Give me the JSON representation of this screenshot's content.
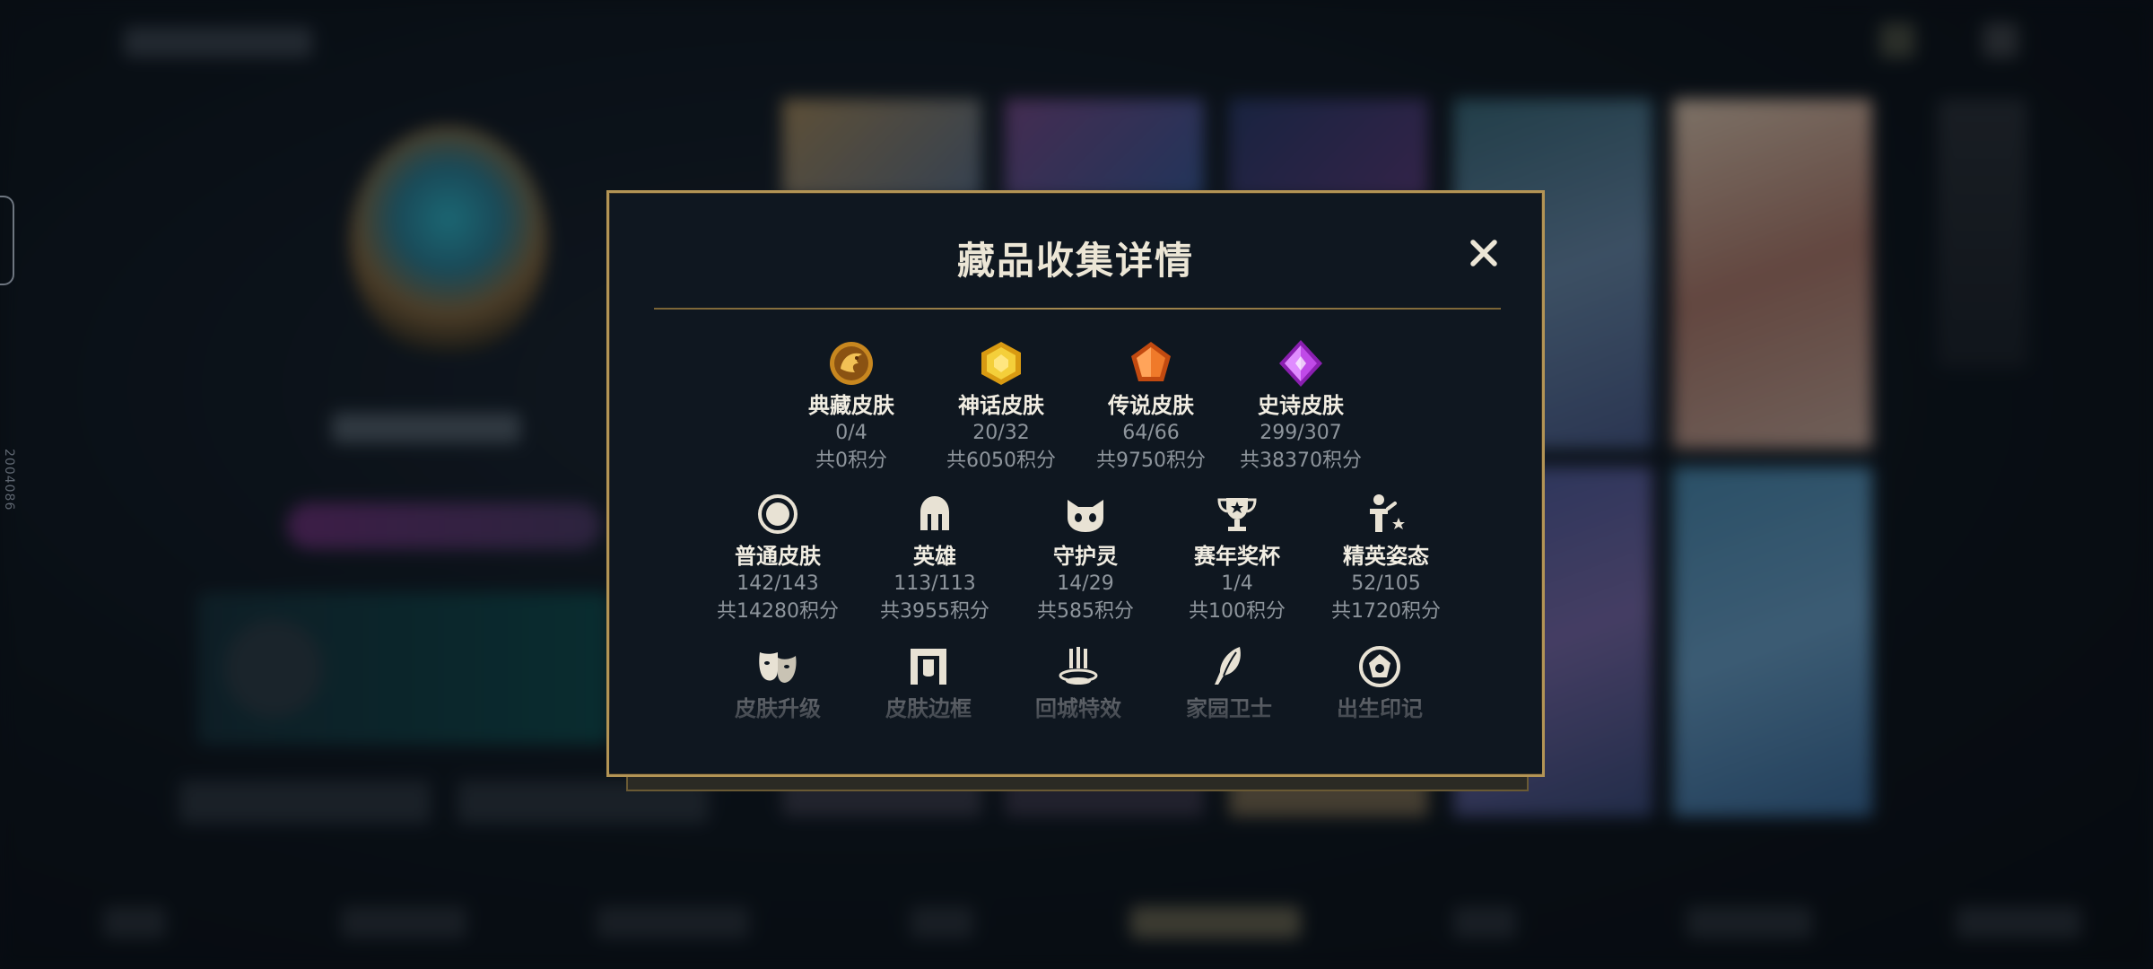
{
  "dialog": {
    "title": "藏品收集详情",
    "accent_color": "#b39455",
    "close_icon": "close-icon"
  },
  "categories_row1": [
    {
      "icon": "dragon-emblem-icon",
      "name": "典藏皮肤",
      "count": "0/4",
      "points": "共0积分"
    },
    {
      "icon": "gold-gem-icon",
      "name": "神话皮肤",
      "count": "20/32",
      "points": "共6050积分"
    },
    {
      "icon": "orange-gem-icon",
      "name": "传说皮肤",
      "count": "64/66",
      "points": "共9750积分"
    },
    {
      "icon": "purple-gem-icon",
      "name": "史诗皮肤",
      "count": "299/307",
      "points": "共38370积分"
    }
  ],
  "categories_row2": [
    {
      "icon": "circle-ring-icon",
      "name": "普通皮肤",
      "count": "142/143",
      "points": "共14280积分"
    },
    {
      "icon": "helmet-icon",
      "name": "英雄",
      "count": "113/113",
      "points": "共3955积分"
    },
    {
      "icon": "cat-face-icon",
      "name": "守护灵",
      "count": "14/29",
      "points": "共585积分"
    },
    {
      "icon": "trophy-icon",
      "name": "赛年奖杯",
      "count": "1/4",
      "points": "共100积分"
    },
    {
      "icon": "elite-pose-icon",
      "name": "精英姿态",
      "count": "52/105",
      "points": "共1720积分"
    }
  ],
  "categories_row3": [
    {
      "icon": "mask-icon",
      "name": "皮肤升级"
    },
    {
      "icon": "frame-icon",
      "name": "皮肤边框"
    },
    {
      "icon": "recall-effect-icon",
      "name": "回城特效"
    },
    {
      "icon": "feather-icon",
      "name": "家园卫士"
    },
    {
      "icon": "birth-seal-icon",
      "name": "出生印记"
    }
  ],
  "side_text": "2004086"
}
